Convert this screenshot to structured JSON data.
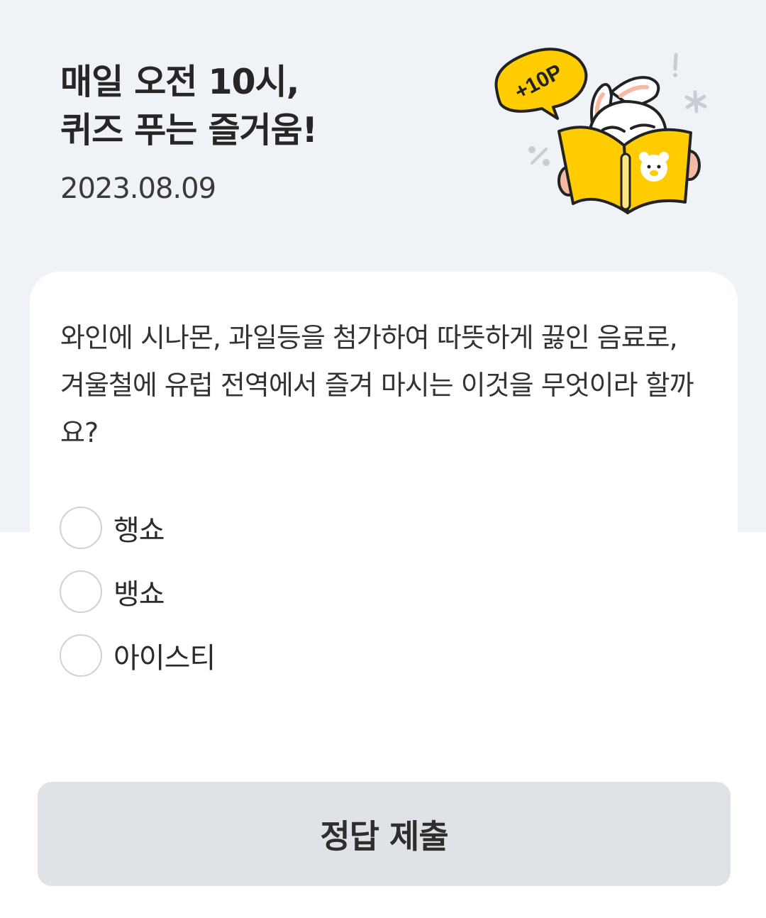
{
  "header": {
    "title_line1": "매일 오전 10시,",
    "title_line2": "퀴즈 푸는 즐거움!",
    "date": "2023.08.09",
    "badge": "+10P"
  },
  "quiz": {
    "question": "와인에 시나몬, 과일등을 첨가하여 따뜻하게 끓인 음료로, 겨울철에 유럽 전역에서 즐겨 마시는 이것을 무엇이라 할까요?",
    "options": [
      {
        "label": "행쇼"
      },
      {
        "label": "뱅쇼"
      },
      {
        "label": "아이스티"
      }
    ]
  },
  "submit": {
    "label": "정답 제출"
  },
  "colors": {
    "header_bg": "#eff2f7",
    "book_yellow": "#ffcc00",
    "submit_bg": "#dfe2e7"
  }
}
